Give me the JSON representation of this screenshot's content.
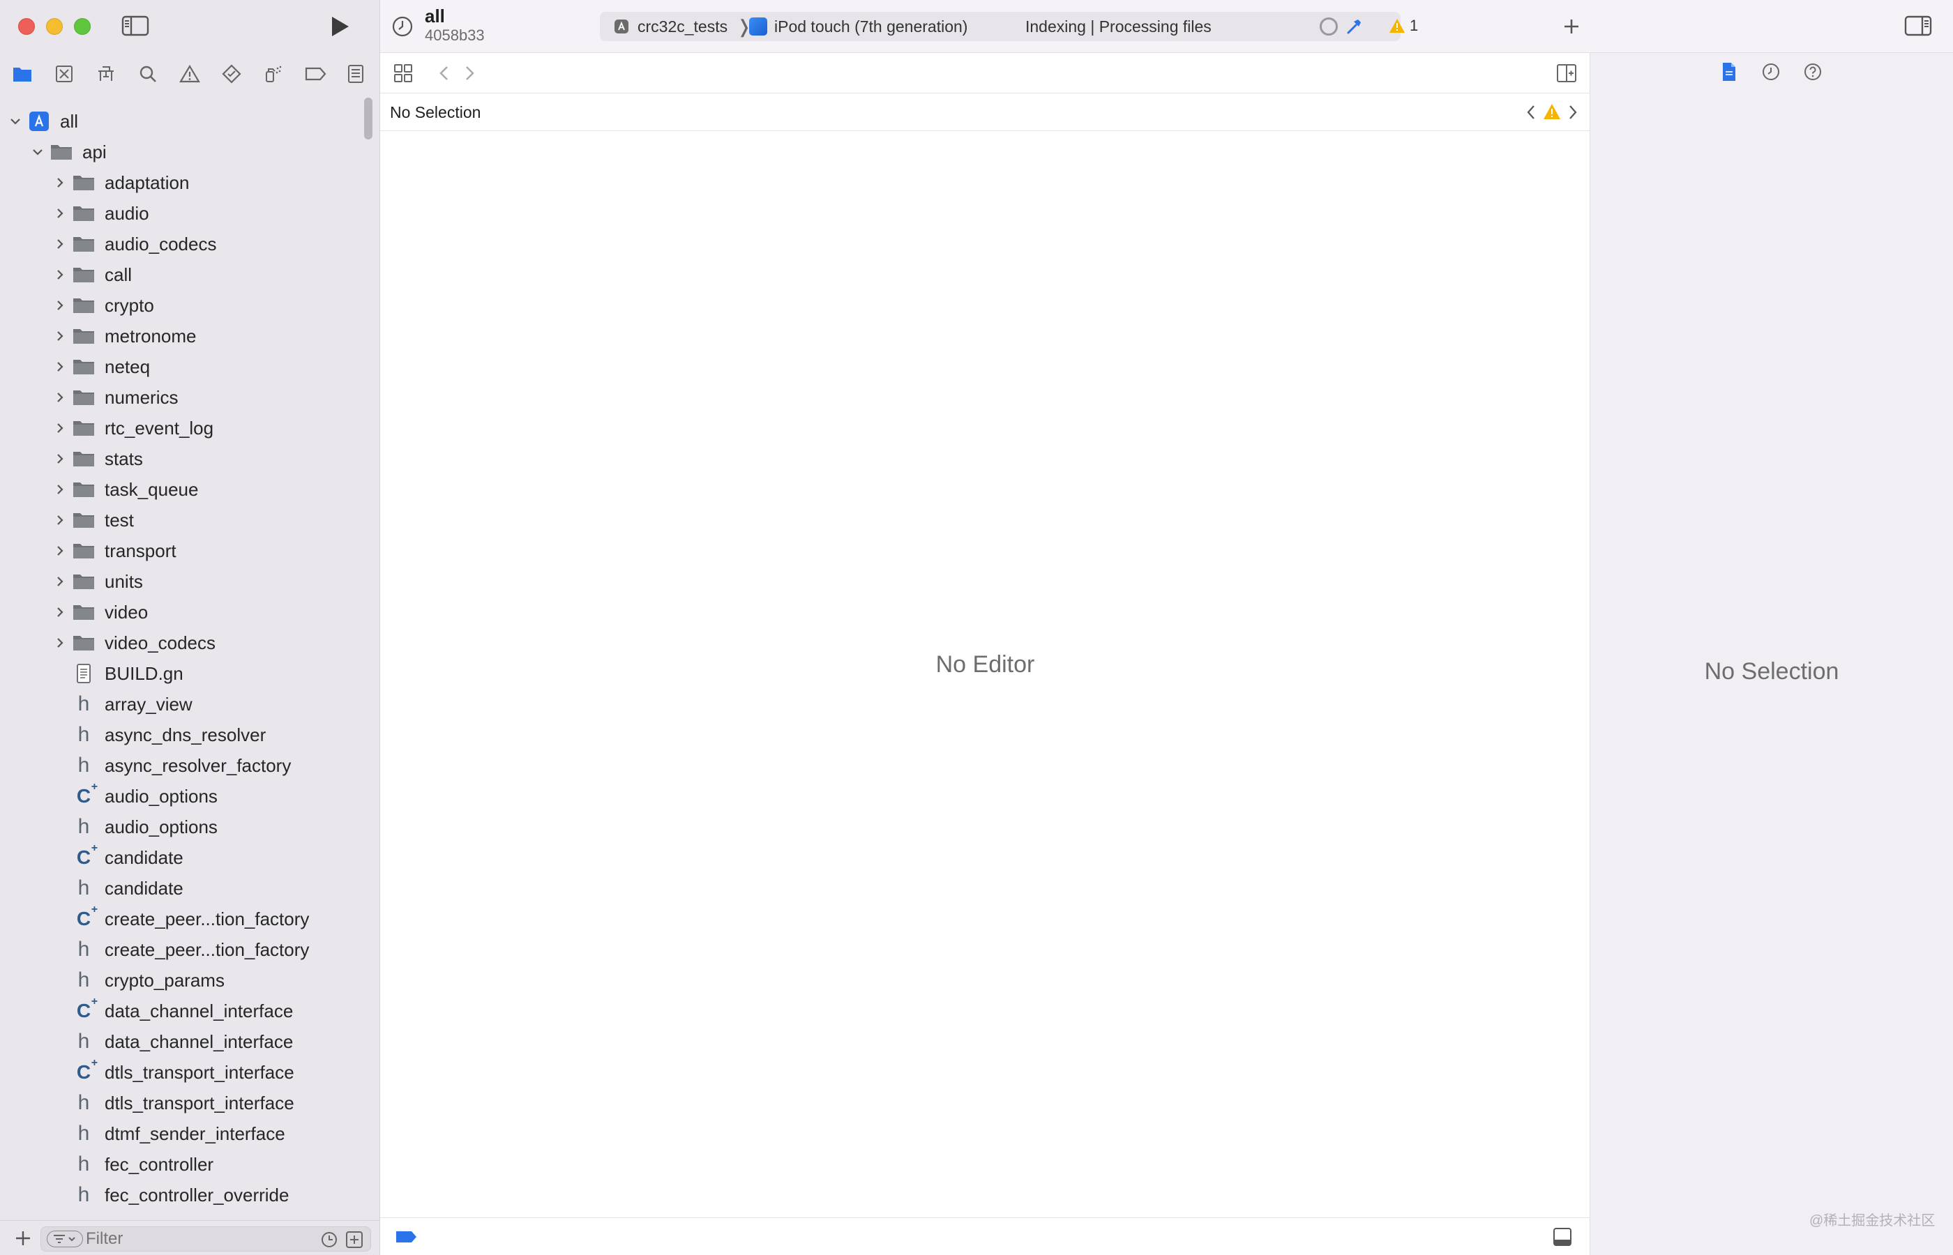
{
  "toolbar": {
    "scheme_title": "all",
    "scheme_subtitle": "4058b33",
    "activity": {
      "scheme": "crc32c_tests",
      "device": "iPod touch (7th generation)",
      "status": "Indexing | Processing files"
    },
    "warnings_count": "1"
  },
  "navigator": {
    "tabs": [
      "folder-icon",
      "source-control-icon",
      "symbol-icon",
      "search-icon",
      "issue-icon",
      "test-icon",
      "debug-icon",
      "breakpoint-icon",
      "report-icon"
    ],
    "tree": [
      {
        "label": "all",
        "level": 0,
        "type": "project",
        "expanded": true
      },
      {
        "label": "api",
        "level": 1,
        "type": "folder",
        "expanded": true
      },
      {
        "label": "adaptation",
        "level": 2,
        "type": "folder",
        "expanded": false
      },
      {
        "label": "audio",
        "level": 2,
        "type": "folder",
        "expanded": false
      },
      {
        "label": "audio_codecs",
        "level": 2,
        "type": "folder",
        "expanded": false
      },
      {
        "label": "call",
        "level": 2,
        "type": "folder",
        "expanded": false
      },
      {
        "label": "crypto",
        "level": 2,
        "type": "folder",
        "expanded": false
      },
      {
        "label": "metronome",
        "level": 2,
        "type": "folder",
        "expanded": false
      },
      {
        "label": "neteq",
        "level": 2,
        "type": "folder",
        "expanded": false
      },
      {
        "label": "numerics",
        "level": 2,
        "type": "folder",
        "expanded": false
      },
      {
        "label": "rtc_event_log",
        "level": 2,
        "type": "folder",
        "expanded": false
      },
      {
        "label": "stats",
        "level": 2,
        "type": "folder",
        "expanded": false
      },
      {
        "label": "task_queue",
        "level": 2,
        "type": "folder",
        "expanded": false
      },
      {
        "label": "test",
        "level": 2,
        "type": "folder",
        "expanded": false
      },
      {
        "label": "transport",
        "level": 2,
        "type": "folder",
        "expanded": false
      },
      {
        "label": "units",
        "level": 2,
        "type": "folder",
        "expanded": false
      },
      {
        "label": "video",
        "level": 2,
        "type": "folder",
        "expanded": false
      },
      {
        "label": "video_codecs",
        "level": 2,
        "type": "folder",
        "expanded": false
      },
      {
        "label": "BUILD.gn",
        "level": 2,
        "type": "doc"
      },
      {
        "label": "array_view",
        "level": 2,
        "type": "h"
      },
      {
        "label": "async_dns_resolver",
        "level": 2,
        "type": "h"
      },
      {
        "label": "async_resolver_factory",
        "level": 2,
        "type": "h"
      },
      {
        "label": "audio_options",
        "level": 2,
        "type": "cpp"
      },
      {
        "label": "audio_options",
        "level": 2,
        "type": "h"
      },
      {
        "label": "candidate",
        "level": 2,
        "type": "cpp"
      },
      {
        "label": "candidate",
        "level": 2,
        "type": "h"
      },
      {
        "label": "create_peer...tion_factory",
        "level": 2,
        "type": "cpp"
      },
      {
        "label": "create_peer...tion_factory",
        "level": 2,
        "type": "h"
      },
      {
        "label": "crypto_params",
        "level": 2,
        "type": "h"
      },
      {
        "label": "data_channel_interface",
        "level": 2,
        "type": "cpp"
      },
      {
        "label": "data_channel_interface",
        "level": 2,
        "type": "h"
      },
      {
        "label": "dtls_transport_interface",
        "level": 2,
        "type": "cpp"
      },
      {
        "label": "dtls_transport_interface",
        "level": 2,
        "type": "h"
      },
      {
        "label": "dtmf_sender_interface",
        "level": 2,
        "type": "h"
      },
      {
        "label": "fec_controller",
        "level": 2,
        "type": "h"
      },
      {
        "label": "fec_controller_override",
        "level": 2,
        "type": "h"
      }
    ],
    "filter_placeholder": "Filter"
  },
  "editor": {
    "jump_bar_text": "No Selection",
    "empty_text": "No Editor"
  },
  "inspector": {
    "empty_text": "No Selection"
  },
  "watermark": "@稀土掘金技术社区",
  "colors": {
    "accent": "#2a73e8",
    "warning": "#f5b400",
    "folder": "#6e7276",
    "sidebar_bg": "#e9e6ec"
  }
}
